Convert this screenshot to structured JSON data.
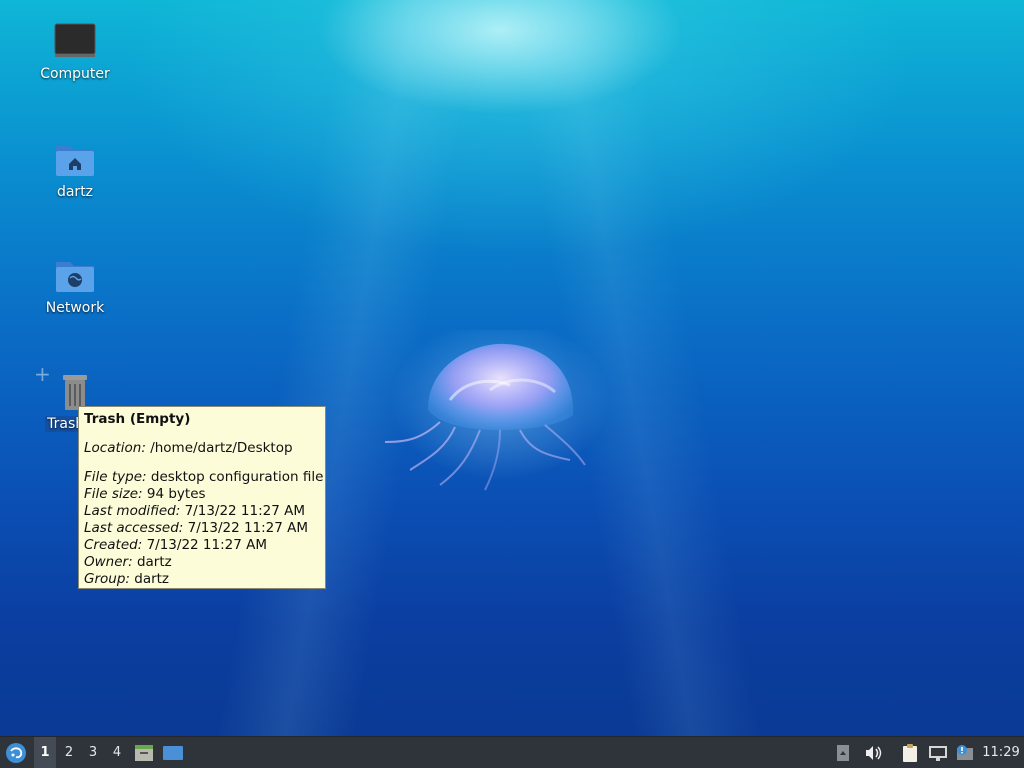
{
  "desktop": {
    "icons": [
      {
        "label": "Computer"
      },
      {
        "label": "dartz"
      },
      {
        "label": "Network"
      },
      {
        "label": "Trash (E"
      }
    ]
  },
  "tooltip": {
    "title": "Trash (Empty)",
    "location_key": "Location:",
    "location_value": "/home/dartz/Desktop",
    "file_type_key": "File type:",
    "file_type_value": "desktop configuration file",
    "file_size_key": "File size:",
    "file_size_value": "94 bytes",
    "last_modified_key": "Last modified:",
    "last_modified_value": "7/13/22 11:27 AM",
    "last_accessed_key": "Last accessed:",
    "last_accessed_value": "7/13/22 11:27 AM",
    "created_key": "Created:",
    "created_value": "7/13/22 11:27 AM",
    "owner_key": "Owner:",
    "owner_value": "dartz",
    "group_key": "Group:",
    "group_value": "dartz"
  },
  "taskbar": {
    "menu_icon": "start-menu-icon",
    "workspaces": [
      "1",
      "2",
      "3",
      "4"
    ],
    "active_workspace": "1",
    "launchers": [
      "file-manager-icon",
      "show-desktop-icon"
    ],
    "tray_icons": [
      "tray-expand-icon",
      "volume-icon",
      "clipboard-icon",
      "network-icon",
      "update-notifier-icon"
    ],
    "clock": "11:29"
  },
  "colors": {
    "taskbar_bg": "#2f343b",
    "tooltip_bg": "#fdfcd8",
    "folder_blue": "#4a90d9"
  }
}
